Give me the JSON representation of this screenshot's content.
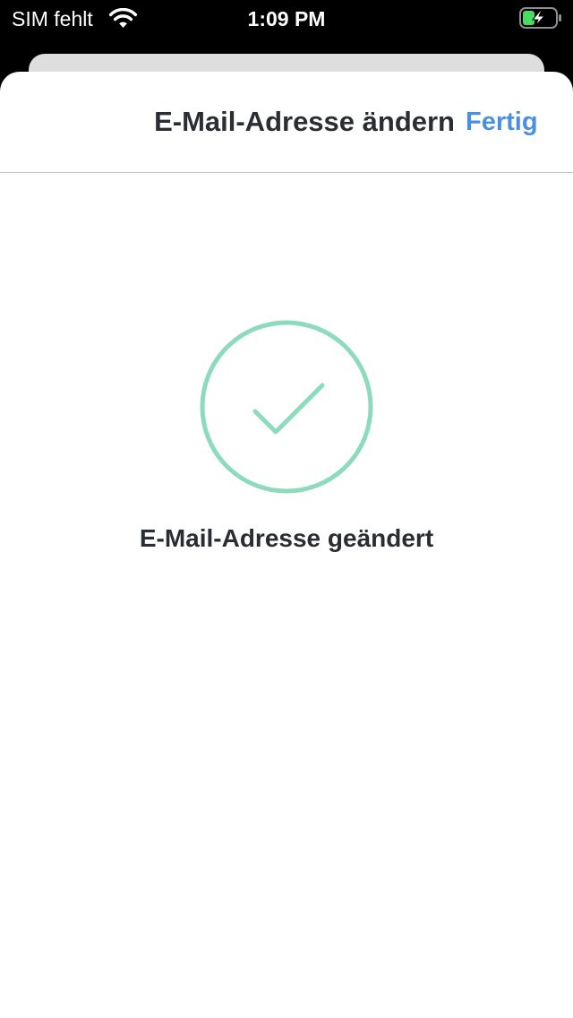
{
  "status_bar": {
    "carrier": "SIM fehlt",
    "time": "1:09 PM",
    "wifi_icon": "wifi-icon",
    "battery_icon": "battery-charging-icon",
    "battery_color": "#4cd964"
  },
  "nav": {
    "title": "E-Mail-Adresse ändern",
    "done_label": "Fertig",
    "done_color": "#4a90e2"
  },
  "main": {
    "icon": "checkmark-circle-icon",
    "icon_color": "#8ddbbd",
    "message": "E-Mail-Adresse geändert"
  }
}
